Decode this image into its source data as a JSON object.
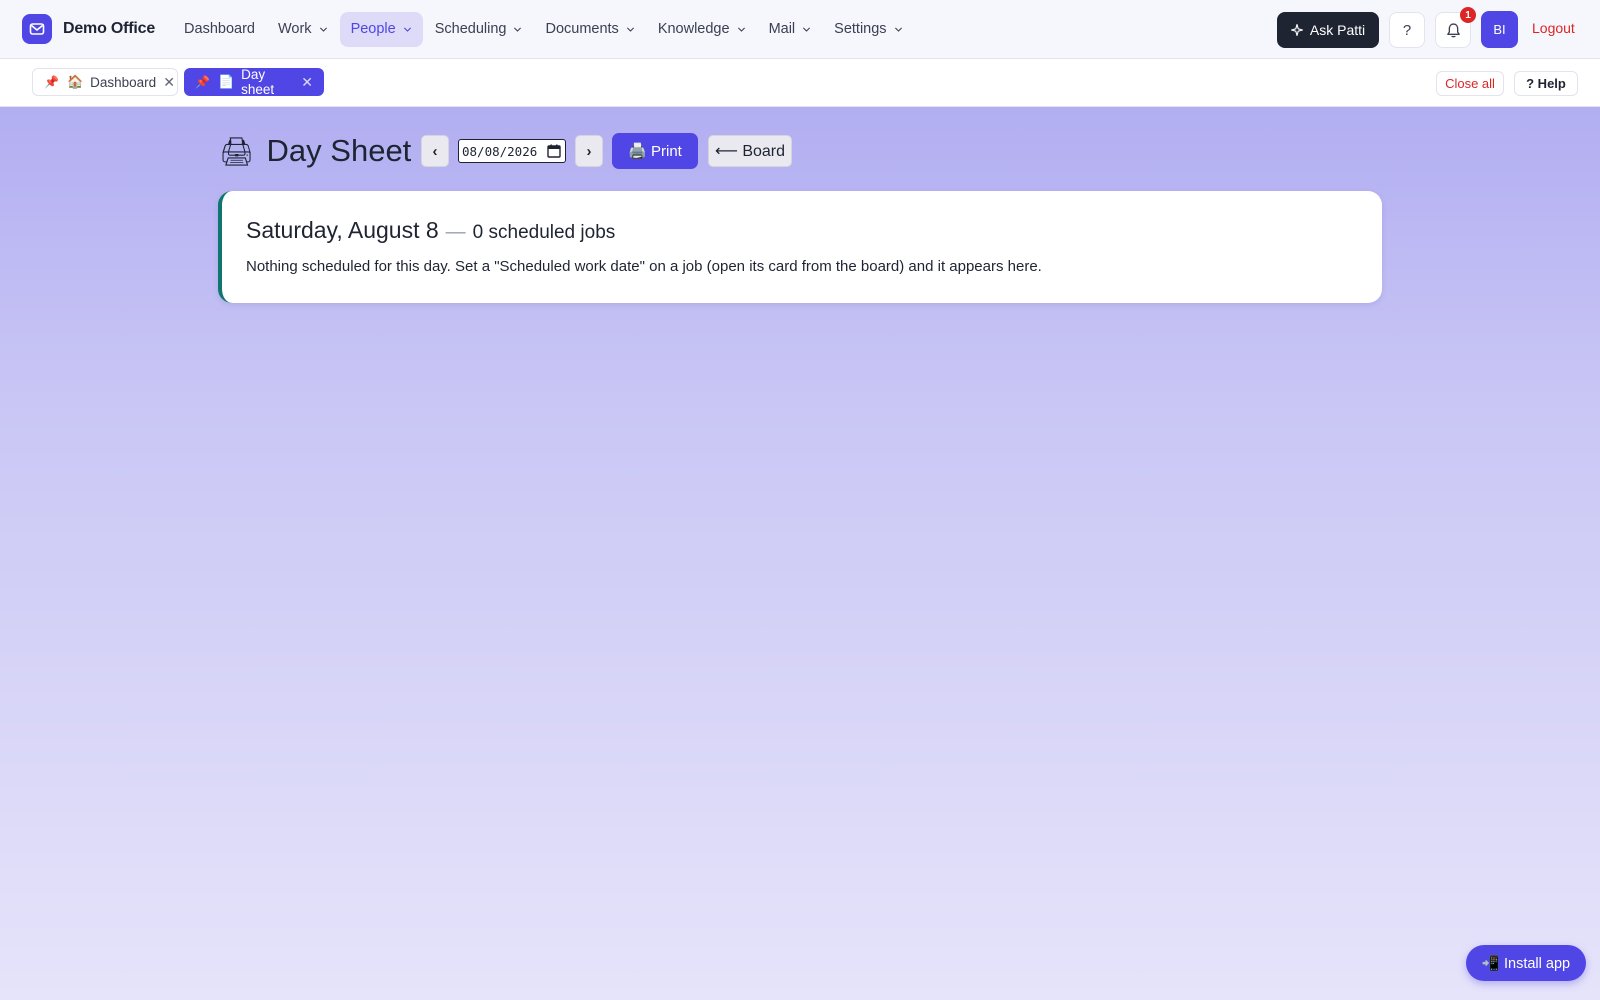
{
  "brand": {
    "name": "Demo Office",
    "logo_icon": "mail-icon",
    "accent": "#4f46e5"
  },
  "nav": {
    "items": [
      {
        "label": "Dashboard",
        "dropdown": false,
        "active": false
      },
      {
        "label": "Work",
        "dropdown": true,
        "active": false
      },
      {
        "label": "People",
        "dropdown": true,
        "active": true
      },
      {
        "label": "Scheduling",
        "dropdown": true,
        "active": false
      },
      {
        "label": "Documents",
        "dropdown": true,
        "active": false
      },
      {
        "label": "Knowledge",
        "dropdown": true,
        "active": false
      },
      {
        "label": "Mail",
        "dropdown": true,
        "active": false
      },
      {
        "label": "Settings",
        "dropdown": true,
        "active": false
      }
    ],
    "ask_label": "Ask Patti",
    "ask_icon": "sparkle-icon",
    "help_label": "?",
    "notification_count": "1",
    "avatar_initials": "BI",
    "logout_label": "Logout"
  },
  "tabs": {
    "items": [
      {
        "pin": "📌",
        "icon": "🏠",
        "label": "Dashboard",
        "close": "✕"
      },
      {
        "pin": "📌",
        "icon": "📄",
        "label": "Day sheet",
        "close": "✕"
      }
    ],
    "close_all_label": "Close all",
    "help_label": "? Help"
  },
  "toolbar": {
    "title_icon": "🖨",
    "title": "Day Sheet",
    "prev_label": "‹",
    "next_label": "›",
    "date_value": "08/08/2026",
    "print_label": "🖨️ Print",
    "board_label": "⟵ Board"
  },
  "card": {
    "date": "Saturday, August 8",
    "dash": "—",
    "count": "0 scheduled jobs",
    "message": "Nothing scheduled for this day. Set a \"Scheduled work date\" on a job (open its card from the board) and it appears here."
  },
  "install": {
    "label": "📲 Install app"
  }
}
